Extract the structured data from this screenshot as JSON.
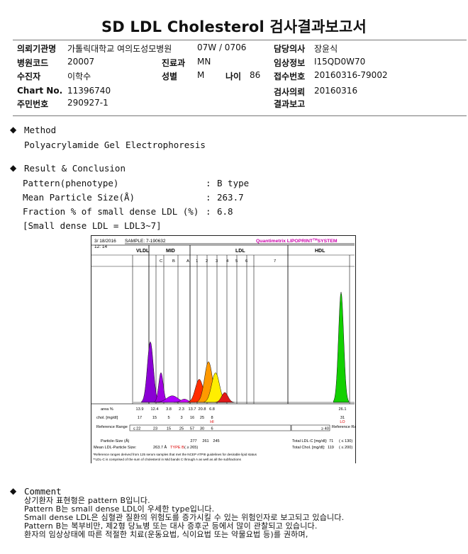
{
  "title": "SD LDL Cholesterol 검사결과보고서",
  "info": {
    "r1": {
      "l1": "의뢰기관명",
      "v1": "가톨릭대학교 여의도성모병원",
      "v2": "07W / 0706",
      "l3": "담당의사",
      "v3": "장윤식"
    },
    "r2": {
      "l1": "병원코드",
      "v1": "20007",
      "l2": "진료과",
      "v2": "MN",
      "l3": "임상정보",
      "v3": "I15QD0W70"
    },
    "r3": {
      "l1": "수진자",
      "v1": "이학수",
      "l2": "성별",
      "v2": "M",
      "l2b": "나이",
      "v2b": "86",
      "l3": "접수번호",
      "v3": "20160316-79002"
    },
    "r4": {
      "l1": "Chart No.",
      "v1": "11396740",
      "l3": "검사의뢰",
      "v3": "20160316"
    },
    "r5": {
      "l1": "주민번호",
      "v1": "290927-1",
      "l3": "결과보고",
      "v3": ""
    }
  },
  "method": {
    "heading": "Method",
    "text": "Polyacrylamide Gel Electrophoresis"
  },
  "result": {
    "heading": "Result & Conclusion",
    "rows": [
      {
        "label": "Pattern(phenotype)",
        "colon": ":",
        "value": "B type"
      },
      {
        "label": "Mean Particle Size(Å)",
        "colon": ":",
        "value": "263.7"
      },
      {
        "label": "Fraction % of small dense LDL (%)",
        "colon": ":",
        "value": "6.8"
      }
    ],
    "note": "[Small dense LDL = LDL3~7]"
  },
  "chart_data": {
    "type": "area",
    "header": {
      "date": "3/ 18/2016",
      "time": "12: 14",
      "sample": "SAMPLE:  7-190632",
      "brand": "Quantimetrix LIPOPRINT",
      "brand_tm": "TM",
      "brand_tail": "SYSTEM"
    },
    "groups": [
      "VLDL",
      "MID",
      "LDL",
      "HDL"
    ],
    "bands": [
      "C",
      "B",
      "A",
      "1",
      "2",
      "3",
      "4",
      "5",
      "6",
      "7"
    ],
    "area_label": "area %",
    "area_values": [
      "13.9",
      "12.4",
      "3.8",
      "2.3",
      "13.7",
      "20.8",
      "6.8"
    ],
    "area_hdl": "26.1",
    "chol_label": "chol. [mg/dl]",
    "chol_values": [
      "17",
      "15",
      "5",
      "3",
      "16",
      "25",
      "8"
    ],
    "chol_hdl": "31",
    "chol_flag": "HI",
    "chol_hdl_flag": "LO",
    "ref_label": "Reference Range",
    "ref_values": [
      "≤ 22",
      "23",
      "15",
      "25",
      "57",
      "30",
      "6"
    ],
    "ref_hdl": "≥ 40",
    "particle_label": "Particle-Size (Å)",
    "particle_values": [
      "277",
      "261",
      "245"
    ],
    "mean_label": "Mean LDL-Particle Size:",
    "mean_value": "263.7 Å",
    "mean_type": "TYPE B",
    "mean_ref": "( ≥ 265)",
    "total_ldl_label": "Total LDL-C [mg/dl]:",
    "total_ldl": "71",
    "total_ldl_ref": "( ≤ 130)",
    "total_chol_label": "Total Chol. [mg/dl]:",
    "total_chol": "119",
    "total_chol_ref": "( ≤ 200)",
    "footnote1": "*Reference ranges derived from 125 serum samples that met the NCEP ATPIII guidelines for desirable lipid status",
    "footnote2": "**LDL-C is comprised of the sum of cholesterol in Mid bands C through A as well as all the subfractions",
    "peaks": [
      {
        "band": "VLDL",
        "rel_height": 0.55,
        "color": "#8a00d4"
      },
      {
        "band": "C",
        "rel_height": 0.27,
        "color": "#a000e0"
      },
      {
        "band": "B",
        "rel_height": 0.06,
        "color": "#b000ff"
      },
      {
        "band": "A",
        "rel_height": 0.03,
        "color": "#cc00ff"
      },
      {
        "band": "1",
        "rel_height": 0.21,
        "color": "#ff2d00"
      },
      {
        "band": "2",
        "rel_height": 0.37,
        "color": "#ff9900"
      },
      {
        "band": "3",
        "rel_height": 0.27,
        "color": "#ffee00"
      },
      {
        "band": "4",
        "rel_height": 0.09,
        "color": "#e01818"
      },
      {
        "band": "HDL",
        "rel_height": 1.0,
        "color": "#13d000"
      }
    ]
  },
  "comment": {
    "heading": "Comment",
    "lines": [
      "상기환자 표현형은 pattern B입니다.",
      "Pattern B는 small dense LDL이 우세한 type입니다.",
      "Small dense LDL은 심혈관 질환의 위험도를 증가시킬 수 있는 위험인자로 보고되고 있습니다.",
      "Pattern B는 복부비만, 제2형 당뇨병 또는 대사 증후군 등에서 많이 관찰되고 있습니다.",
      "환자의 임상상태에 따른 적절한 치료(운동요법, 식이요법 또는 약물요법 등)를 권하며,"
    ]
  },
  "colors": {
    "vldl": "#8a00d4",
    "mid": "#b000ff",
    "ldl_small": "#ff2d00",
    "hdl": "#13d000",
    "brand": "#cc00aa"
  }
}
